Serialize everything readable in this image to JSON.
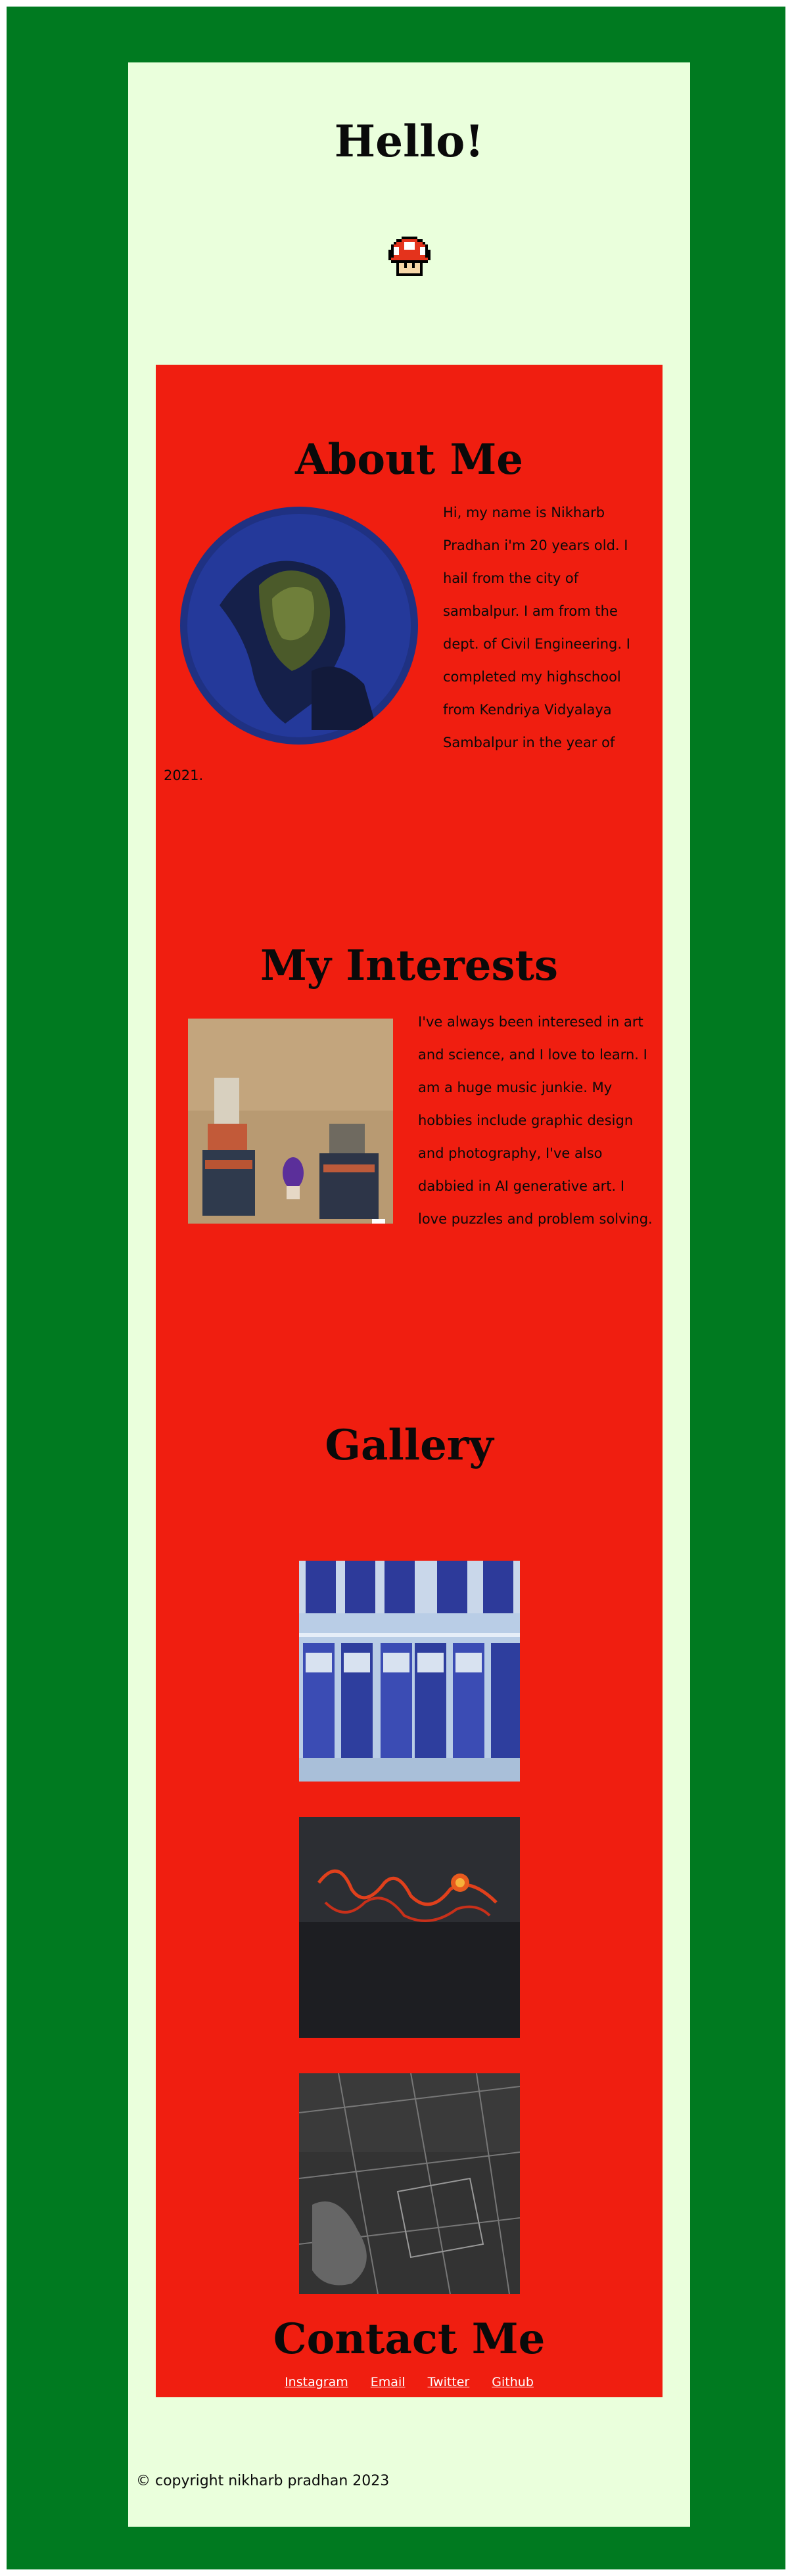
{
  "header": {
    "title": "Hello!"
  },
  "about": {
    "title": "About Me",
    "text": "Hi, my name is Nikharb Pradhan i'm 20 years old. I hail from the city of sambalpur. I am from the dept. of Civil Engineering. I completed my highschool from Kendriya Vidyalaya Sambalpur in the year of 2021."
  },
  "interests": {
    "title": "My Interests",
    "text": "I've always been interesed in art and science, and I love to learn. I am a huge music junkie. My hobbies include graphic design and photography, I've also dabbied in AI generative art. I love puzzles and problem solving."
  },
  "gallery": {
    "title": "Gallery"
  },
  "contact": {
    "title": "Contact Me",
    "links": [
      "Instagram",
      "Email",
      "Twitter",
      "Github"
    ]
  },
  "footer": {
    "copyright": "© copyright nikharb pradhan 2023"
  },
  "colors": {
    "outer_frame": "#007a20",
    "page_background": "#eaffdc",
    "panel": "#f01e10",
    "link": "#ffffff"
  },
  "icons": {
    "header_icon": "mushroom-icon"
  }
}
